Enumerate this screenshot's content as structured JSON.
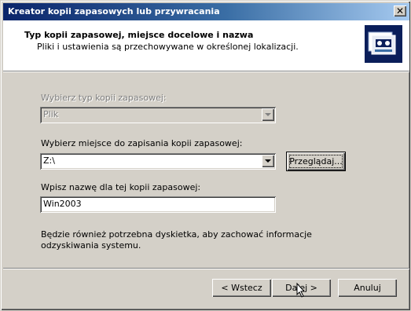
{
  "window": {
    "title": "Kreator kopii zapasowych lub przywracania",
    "close_glyph": "✕"
  },
  "header": {
    "title": "Typ kopii zapasowej, miejsce docelowe i nazwa",
    "subtitle": "Pliki i ustawienia są przechowywane w określonej lokalizacji."
  },
  "form": {
    "type_label": "Wybierz typ kopii zapasowej:",
    "type_value": "Plik",
    "location_label": "Wybierz miejsce do zapisania kopii zapasowej:",
    "location_value": "Z:\\",
    "browse_label": "Przeglądaj...",
    "name_label": "Wpisz nazwę dla tej kopii zapasowej:",
    "name_value": "Win2003",
    "note": "Będzie również potrzebna dyskietka, aby zachować informacje\nodzyskiwania systemu."
  },
  "buttons": {
    "back_label": "< Wstecz",
    "next_label": "Dalej >",
    "cancel_label": "Anuluj"
  },
  "colors": {
    "title_bar_start": "#0a246a",
    "title_bar_end": "#a6caf0",
    "dialog_bg": "#d4d0c8",
    "disabled_text": "#808080"
  },
  "icons": {
    "header": "backup-tape-icon",
    "cursor": "mouse-pointer-icon"
  }
}
